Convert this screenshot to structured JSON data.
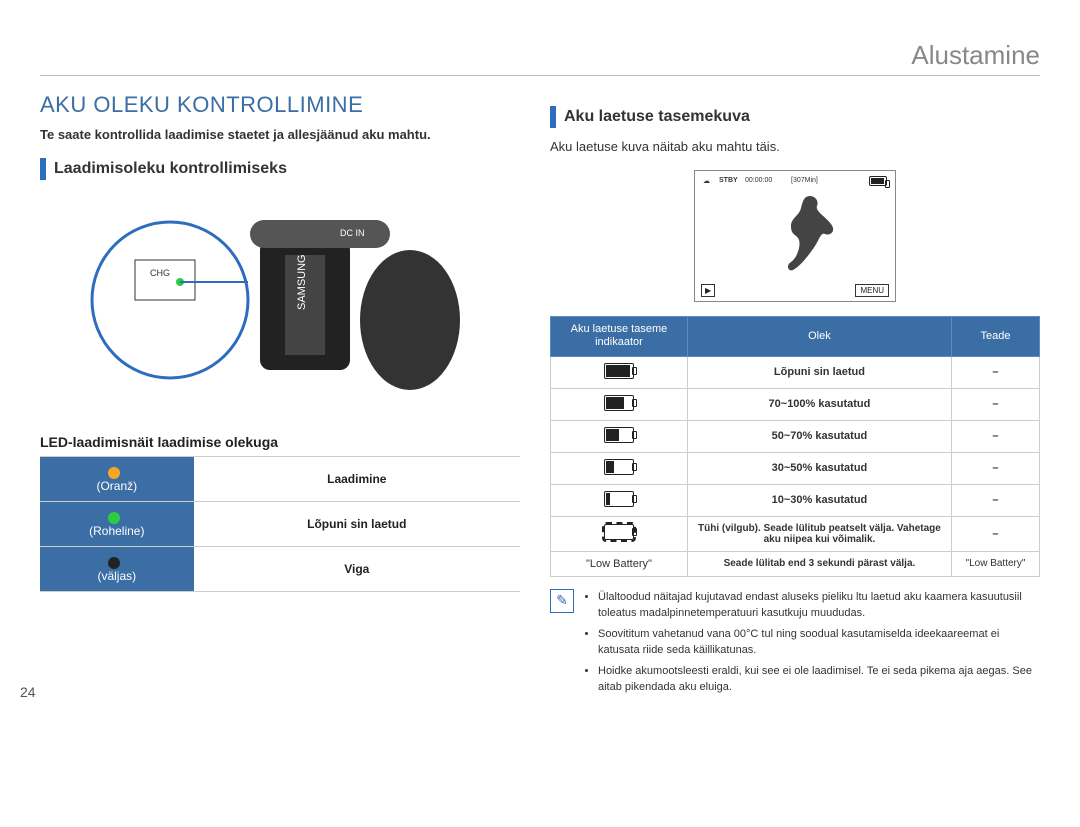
{
  "chapter": "Alustamine",
  "title": "AKU OLEKU KONTROLLIMINE",
  "intro": "Te saate kontrollida laadimise staetet ja allesjäänud aku mahtu.",
  "sub_left": "Laadimisoleku kontrollimiseks",
  "led_caption": "LED-laadimisnäit laadimise olekuga",
  "led": {
    "rows": [
      {
        "color": "(Oranž)",
        "status": "Laadimine"
      },
      {
        "color": "(Roheline)",
        "status": "Lõpuni sin laetud"
      },
      {
        "color": "(väljas)",
        "status": "Viga"
      }
    ]
  },
  "sub_right": "Aku laetuse tasemekuva",
  "intro_right": "Aku laetuse kuva näitab aku mahtu täis.",
  "screen": {
    "stby": "STBY",
    "time": "00:00:00",
    "remain": "[307Min]",
    "res": "MENU",
    "play": "▶"
  },
  "batt_table": {
    "headers": [
      "Aku laetuse taseme indikaator",
      "Olek",
      "Teade"
    ],
    "rows": [
      {
        "fill": "f100",
        "status": "Lõpuni sin laetud",
        "msg": "–"
      },
      {
        "fill": "f70",
        "status": "70~100% kasutatud",
        "msg": "–"
      },
      {
        "fill": "f50",
        "status": "50~70% kasutatud",
        "msg": "–"
      },
      {
        "fill": "f30",
        "status": "30~50% kasutatud",
        "msg": "–"
      },
      {
        "fill": "f10",
        "status": "10~30% kasutatud",
        "msg": "–"
      },
      {
        "fill": "blink",
        "status": "Tühi (vilgub). Seade lülitub peatselt välja. Vahetage aku niipea kui võimalik.",
        "msg": "–"
      },
      {
        "fill": "none",
        "status": "Seade lülitab end 3 sekundi pärast välja.",
        "msg": "\"Low Battery\""
      }
    ]
  },
  "notes": [
    "Ülaltoodud näitajad kujutavad endast aluseks pieliku ltu laetud aku kaamera kasuutusiil toleatus madalpinnetemperatuuri kasutkuju muududas.",
    "Soovititum vahetanud vana 00°C tul ning soodual kasutamiselda ideekaareemat ei katusata riide seda käillikatunas.",
    "Hoidke akumootsleesti eraldi, kui see ei ole laadimisel. Te ei seda pikema aja aegas. See aitab pikendada aku eluiga."
  ],
  "pagenum": "24"
}
